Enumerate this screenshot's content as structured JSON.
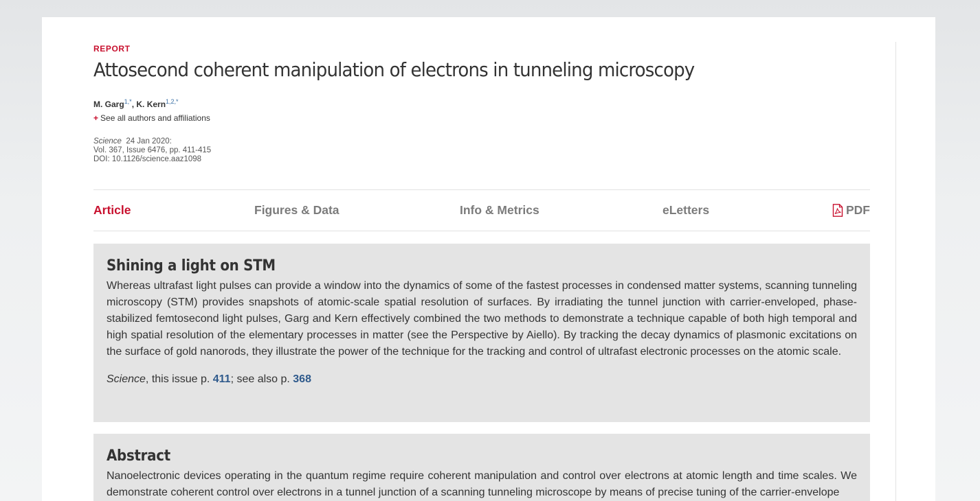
{
  "article": {
    "kicker": "REPORT",
    "title": "Attosecond coherent manipulation of electrons in tunneling microscopy",
    "authors": [
      {
        "name": "M. Garg",
        "sup": "1,*"
      },
      {
        "name": "K. Kern",
        "sup": "1,2,*"
      }
    ],
    "author_separator": ", ",
    "see_all": {
      "icon": "+",
      "label": "See all authors and affiliations"
    },
    "citation": {
      "journal": "Science",
      "date": "24 Jan 2020:",
      "volume_line": "Vol. 367, Issue 6476, pp. 411-415",
      "doi_line": "DOI: 10.1126/science.aaz1098"
    }
  },
  "tabs": [
    {
      "label": "Article",
      "active": true
    },
    {
      "label": "Figures & Data",
      "active": false
    },
    {
      "label": "Info & Metrics",
      "active": false
    },
    {
      "label": "eLetters",
      "active": false
    },
    {
      "label": "PDF",
      "active": false,
      "icon": "pdf-icon"
    }
  ],
  "summary": {
    "heading": "Shining a light on STM",
    "body": "Whereas ultrafast light pulses can provide a window into the dynamics of some of the fastest processes in condensed matter systems, scanning tunneling microscopy (STM) provides snapshots of atomic-scale spatial resolution of surfaces. By irradiating the tunnel junction with carrier-enveloped, phase-stabilized femtosecond light pulses, Garg and Kern effectively combined the two methods to demonstrate a technique capable of both high temporal and high spatial resolution of the elementary processes in matter (see the Perspective by Aiello). By tracking the decay dynamics of plasmonic excitations on the surface of gold nanorods, they illustrate the power of the technique for the tracking and control of ultrafast electronic processes on the atomic scale.",
    "ref_journal": "Science",
    "ref_text1": ", this issue p. ",
    "ref_page1": "411",
    "ref_text2": "; see also p. ",
    "ref_page2": "368"
  },
  "abstract": {
    "heading": "Abstract",
    "body": "Nanoelectronic devices operating in the quantum regime require coherent manipulation and control over electrons at atomic length and time scales. We demonstrate coherent control over electrons in a tunnel junction of a scanning tunneling microscope by means of precise tuning of the carrier-envelope"
  },
  "colors": {
    "accent": "#c8102e",
    "link": "#2f5a8c",
    "panel": "#e4e4e4"
  }
}
